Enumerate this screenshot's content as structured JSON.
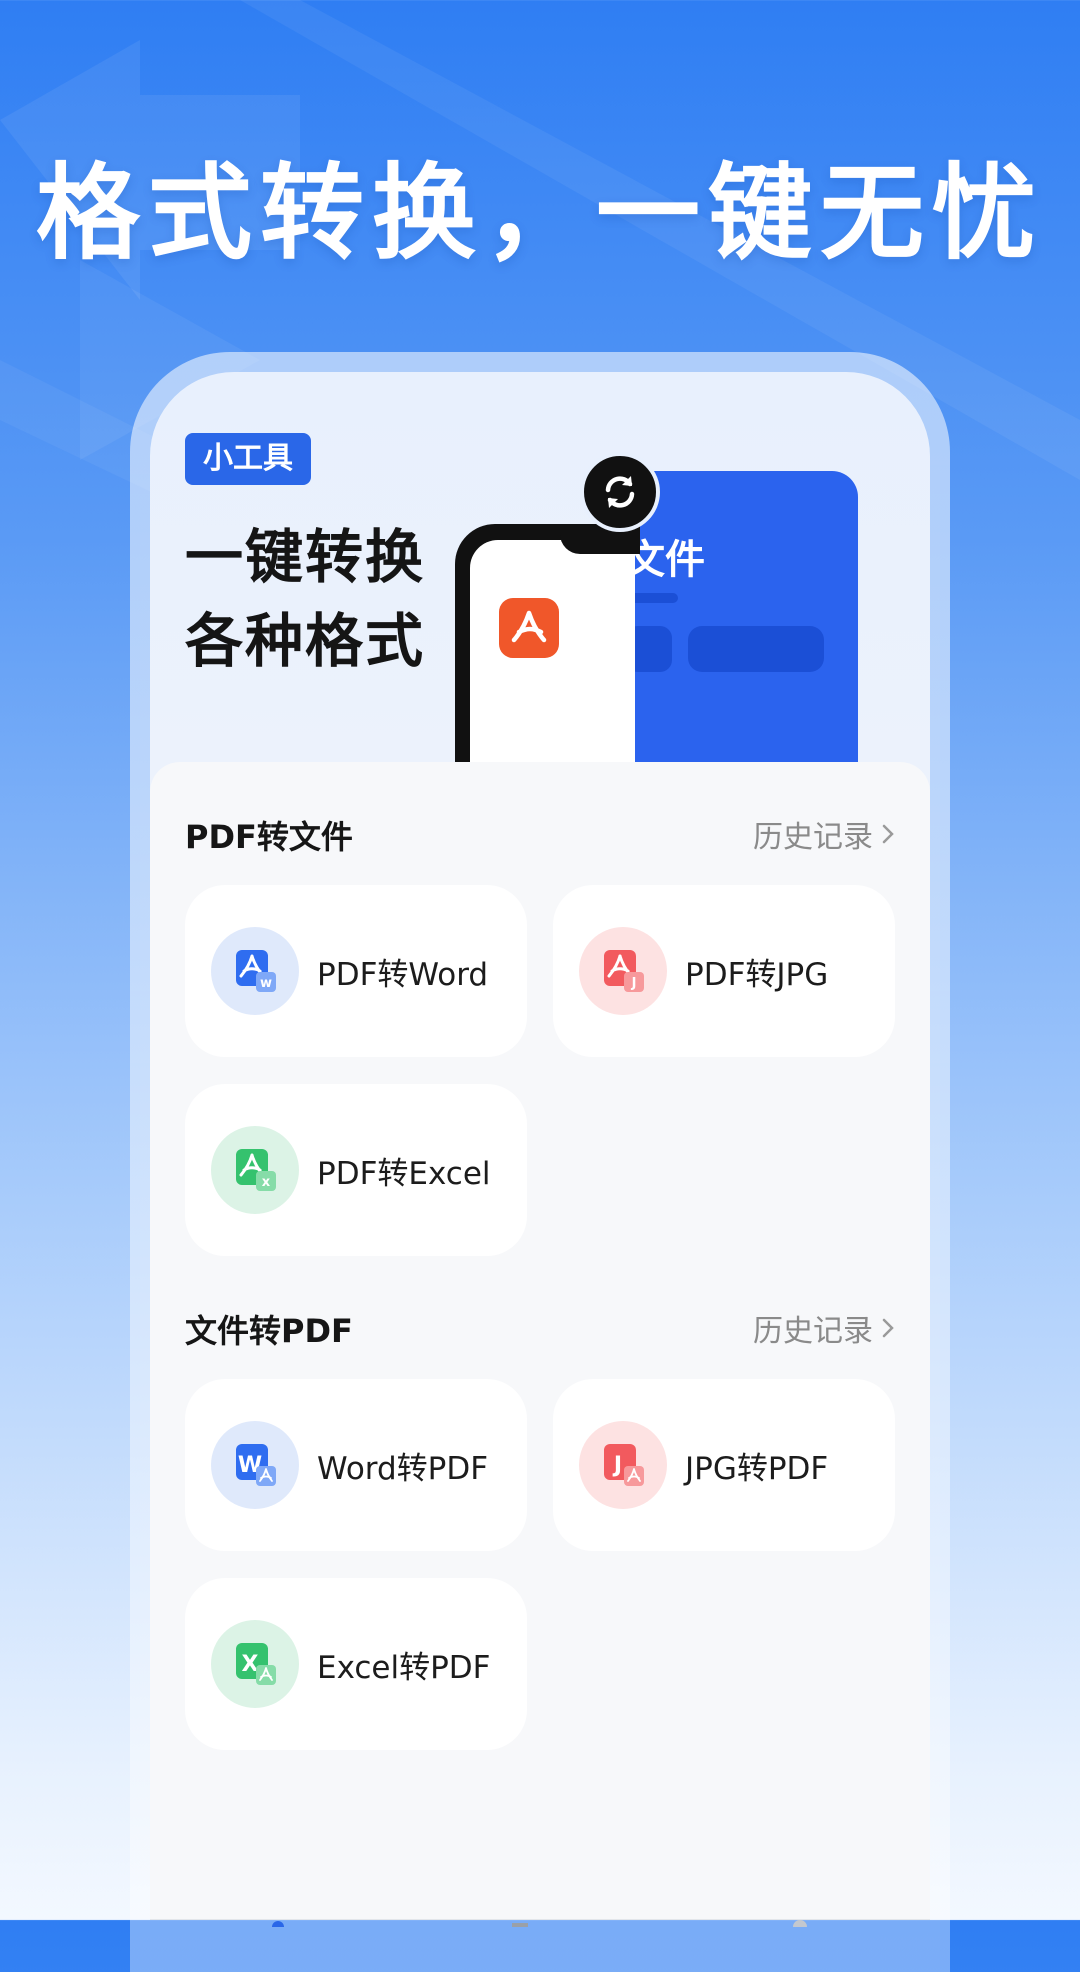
{
  "headline": "格式转换，一键无忧",
  "banner": {
    "badge": "小工具",
    "line1": "一键转换",
    "line2": "各种格式",
    "file_card_title": "文件"
  },
  "sections": [
    {
      "title": "PDF转文件",
      "history": "历史记录",
      "tools": [
        {
          "label": "PDF转Word",
          "icon": "pdf-to-word-icon",
          "color": "#2f6df0",
          "bg": "#dfe9fb"
        },
        {
          "label": "PDF转JPG",
          "icon": "pdf-to-jpg-icon",
          "color": "#f25a5e",
          "bg": "#fde2e2"
        },
        {
          "label": "PDF转Excel",
          "icon": "pdf-to-excel-icon",
          "color": "#35c26e",
          "bg": "#dcf3e6"
        }
      ]
    },
    {
      "title": "文件转PDF",
      "history": "历史记录",
      "tools": [
        {
          "label": "Word转PDF",
          "icon": "word-to-pdf-icon",
          "color": "#2f6df0",
          "bg": "#dfe9fb"
        },
        {
          "label": "JPG转PDF",
          "icon": "jpg-to-pdf-icon",
          "color": "#f25a5e",
          "bg": "#fde2e2"
        },
        {
          "label": "Excel转PDF",
          "icon": "excel-to-pdf-icon",
          "color": "#35c26e",
          "bg": "#dcf3e6"
        }
      ]
    }
  ],
  "colors": {
    "accent": "#2a67e8",
    "pdf_orange": "#f0572a"
  }
}
